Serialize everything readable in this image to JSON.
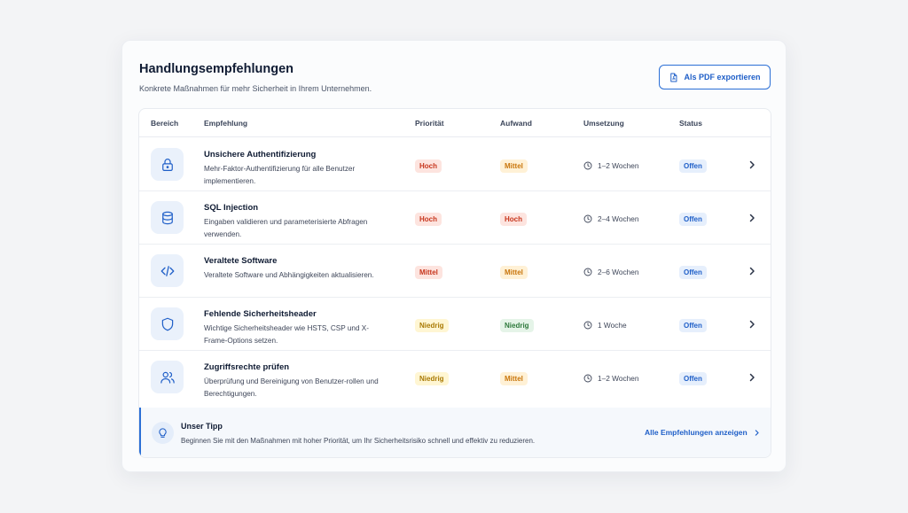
{
  "header": {
    "title": "Handlungsempfehlungen",
    "subtitle": "Konkrete Maßnahmen für mehr Sicherheit in Ihrem Unternehmen.",
    "export_label": "Als PDF exportieren",
    "export_icon": "pdf-file-icon"
  },
  "table": {
    "columns": {
      "bereich": "Bereich",
      "empfehlung": "Empfehlung",
      "prioritaet": "Priorität",
      "aufwand": "Aufwand",
      "umsetzung": "Umsetzung",
      "status": "Status"
    },
    "rows": [
      {
        "icon": "lock-icon",
        "title": "Unsichere Authentifizierung",
        "description": "Mehr-Faktor-Authentifizierung für alle Benutzer implementieren.",
        "priority": "Hoch",
        "effort": "Mittel",
        "duration": "1–2 Wochen",
        "status": "Offen"
      },
      {
        "icon": "database-icon",
        "title": "SQL Injection",
        "description": "Eingaben validieren und parameterisierte Abfragen verwenden.",
        "priority": "Hoch",
        "effort": "Hoch",
        "duration": "2–4 Wochen",
        "status": "Offen"
      },
      {
        "icon": "code-icon",
        "title": "Veraltete Software",
        "description": "Veraltete Software und Abhängigkeiten aktualisieren.",
        "priority": "Mittel",
        "effort": "Mittel",
        "duration": "2–6 Wochen",
        "status": "Offen"
      },
      {
        "icon": "shield-icon",
        "title": "Fehlende Sicherheitsheader",
        "description": "Wichtige Sicherheitsheader wie HSTS, CSP und X-Frame-Options setzen.",
        "priority": "Niedrig",
        "effort": "Niedrig",
        "duration": "1 Woche",
        "status": "Offen"
      },
      {
        "icon": "users-icon",
        "title": "Zugriffsrechte prüfen",
        "description": "Überprüfung und Bereinigung von Benutzer-rollen und Berechtigungen.",
        "priority": "Niedrig",
        "effort": "Mittel",
        "duration": "1–2 Wochen",
        "status": "Offen"
      }
    ]
  },
  "tip": {
    "icon": "lightbulb-icon",
    "title": "Unser Tipp",
    "text": "Beginnen Sie mit den Maßnahmen mit hoher Priorität, um Ihr Sicherheitsrisiko schnell und effektiv zu reduzieren.",
    "link_label": "Alle Empfehlungen anzeigen"
  },
  "colors": {
    "accent": "#1f5fc8",
    "high": "#c7361d",
    "medium": "#c9760c",
    "low_priority": "#a97a05",
    "low_effort": "#2f7a3d"
  }
}
